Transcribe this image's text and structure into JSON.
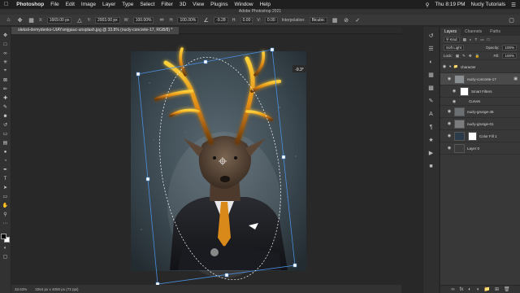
{
  "menubar": {
    "apple": "",
    "app_name": "Photoshop",
    "items": [
      "File",
      "Edit",
      "Image",
      "Layer",
      "Type",
      "Select",
      "Filter",
      "3D",
      "View",
      "Plugins",
      "Window",
      "Help"
    ],
    "clock": "Thu 8:19 PM",
    "user": "Nucly Tutorials"
  },
  "window_title": "Adobe Photoshop 2021",
  "options": {
    "x_label": "X:",
    "x_value": "1669.00 px",
    "y_label": "Y:",
    "y_value": "2003.00 px",
    "w_label": "W:",
    "w_value": "100.00%",
    "h_label": "H:",
    "h_value": "100.00%",
    "angle_value": "-9.28",
    "hskew_label": "H:",
    "hskew_value": "0.00",
    "vskew_label": "V:",
    "vskew_value": "0.00",
    "interp_label": "Interpolation:",
    "interp_value": "Bicubic"
  },
  "document_tab": "oleksii-demydenko-UIAYsmjgauc-unsplash.jpg @ 33.8% (nucly-concrete-17, RGB/8) *",
  "canvas": {
    "rotate_badge": "-9.3°",
    "accent": "#4a8fe0"
  },
  "status": {
    "zoom": "33.63%",
    "dimensions": "3264 px x 4000 px (72 ppi)"
  },
  "panel": {
    "tabs": [
      "Layers",
      "Channels",
      "Paths"
    ],
    "kind_label": "Kind",
    "blend_mode": "Soft Light",
    "opacity_label": "Opacity:",
    "opacity_value": "100%",
    "lock_label": "Lock:",
    "fill_label": "Fill:",
    "fill_value": "100%",
    "layers": [
      {
        "name": "character",
        "type": "group"
      },
      {
        "name": "nucly-concrete-17",
        "type": "smart",
        "selected": true
      },
      {
        "name": "Smart Filters",
        "type": "filter"
      },
      {
        "name": "Curves",
        "type": "filter-item"
      },
      {
        "name": "nucly-grunge-45",
        "type": "normal"
      },
      {
        "name": "nucly-grunge-01",
        "type": "normal"
      },
      {
        "name": "Color Fill 1",
        "type": "fill"
      },
      {
        "name": "Layer 0",
        "type": "normal"
      }
    ]
  }
}
